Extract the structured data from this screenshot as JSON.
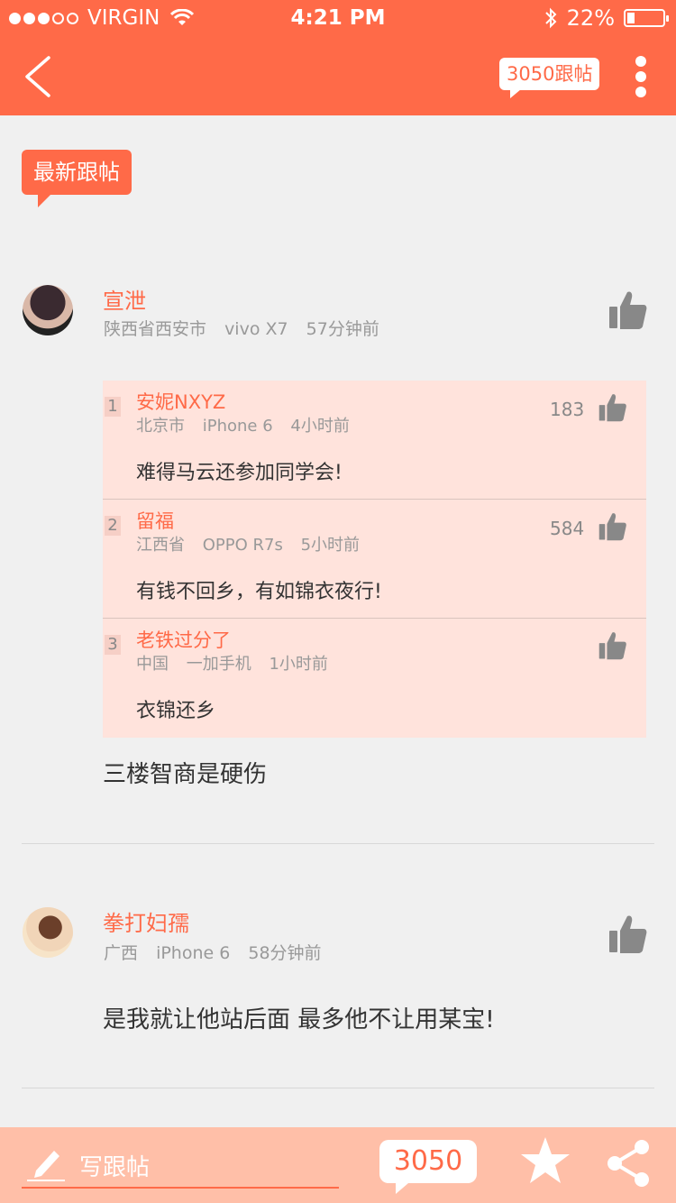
{
  "status_bar": {
    "carrier": "VIRGIN",
    "time": "4:21 PM",
    "battery": "22%",
    "battery_level": 0.22,
    "signal_bars_filled": 3,
    "signal_bars_total": 5
  },
  "nav": {
    "back_icon": "chevron-left-icon",
    "reply_count_label": "3050跟帖",
    "more_icon": "more-vertical-icon"
  },
  "section": {
    "tag_label": "最新跟帖"
  },
  "posts": [
    {
      "author": "宣泄",
      "location": "陕西省西安市",
      "device": "vivo X7",
      "time": "57分钟前",
      "replies": [
        {
          "index": "1",
          "author": "安妮NXYZ",
          "location": "北京市",
          "device": "iPhone 6",
          "time": "4小时前",
          "likes": "183",
          "text": "难得马云还参加同学会!"
        },
        {
          "index": "2",
          "author": "留福",
          "location": "江西省",
          "device": "OPPO R7s",
          "time": "5小时前",
          "likes": "584",
          "text": "有钱不回乡，有如锦衣夜行!"
        },
        {
          "index": "3",
          "author": "老铁过分了",
          "location": "中国",
          "device": "一加手机",
          "time": "1小时前",
          "likes": "",
          "text": "衣锦还乡"
        }
      ],
      "text": "三楼智商是硬伤"
    },
    {
      "author": "拳打妇孺",
      "location": "广西",
      "device": "iPhone 6",
      "time": "58分钟前",
      "text": "是我就让他站后面 最多他不让用某宝!"
    }
  ],
  "bottom_bar": {
    "compose_label": "写跟帖",
    "count": "3050",
    "star_icon": "star-icon",
    "share_icon": "share-icon"
  },
  "colors": {
    "accent": "#ff6a48",
    "reply_bg": "#ffe3dc",
    "bottom_bar_bg": "#ffbfa8"
  }
}
